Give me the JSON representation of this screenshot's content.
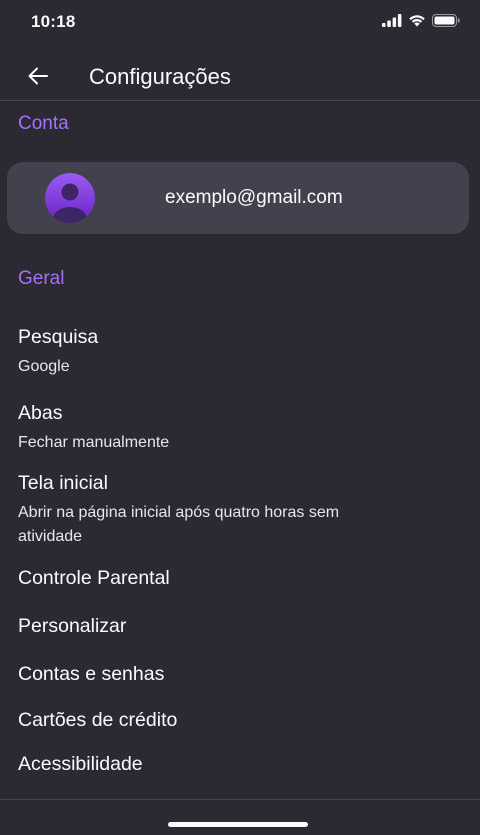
{
  "status_bar": {
    "time": "10:18",
    "icons": [
      "signal-icon",
      "wifi-icon",
      "battery-icon"
    ]
  },
  "header": {
    "title": "Configurações",
    "back_icon": "arrow-left-icon"
  },
  "sections": {
    "account": {
      "label": "Conta",
      "email": "exemplo@gmail.com",
      "avatar_icon": "user-avatar-icon"
    },
    "general": {
      "label": "Geral"
    }
  },
  "settings": [
    {
      "title": "Pesquisa",
      "subtitle": "Google"
    },
    {
      "title": "Abas",
      "subtitle": "Fechar manualmente"
    },
    {
      "title": "Tela inicial",
      "subtitle": "Abrir na página inicial após quatro horas sem atividade"
    },
    {
      "title": "Controle Parental"
    },
    {
      "title": "Personalizar"
    },
    {
      "title": "Contas e senhas"
    },
    {
      "title": "Cartões de crédito"
    },
    {
      "title": "Acessibilidade"
    }
  ],
  "colors": {
    "background": "#2b2a33",
    "section_accent": "#a66efc",
    "card": "#42414d",
    "text": "#fbfbfe"
  }
}
